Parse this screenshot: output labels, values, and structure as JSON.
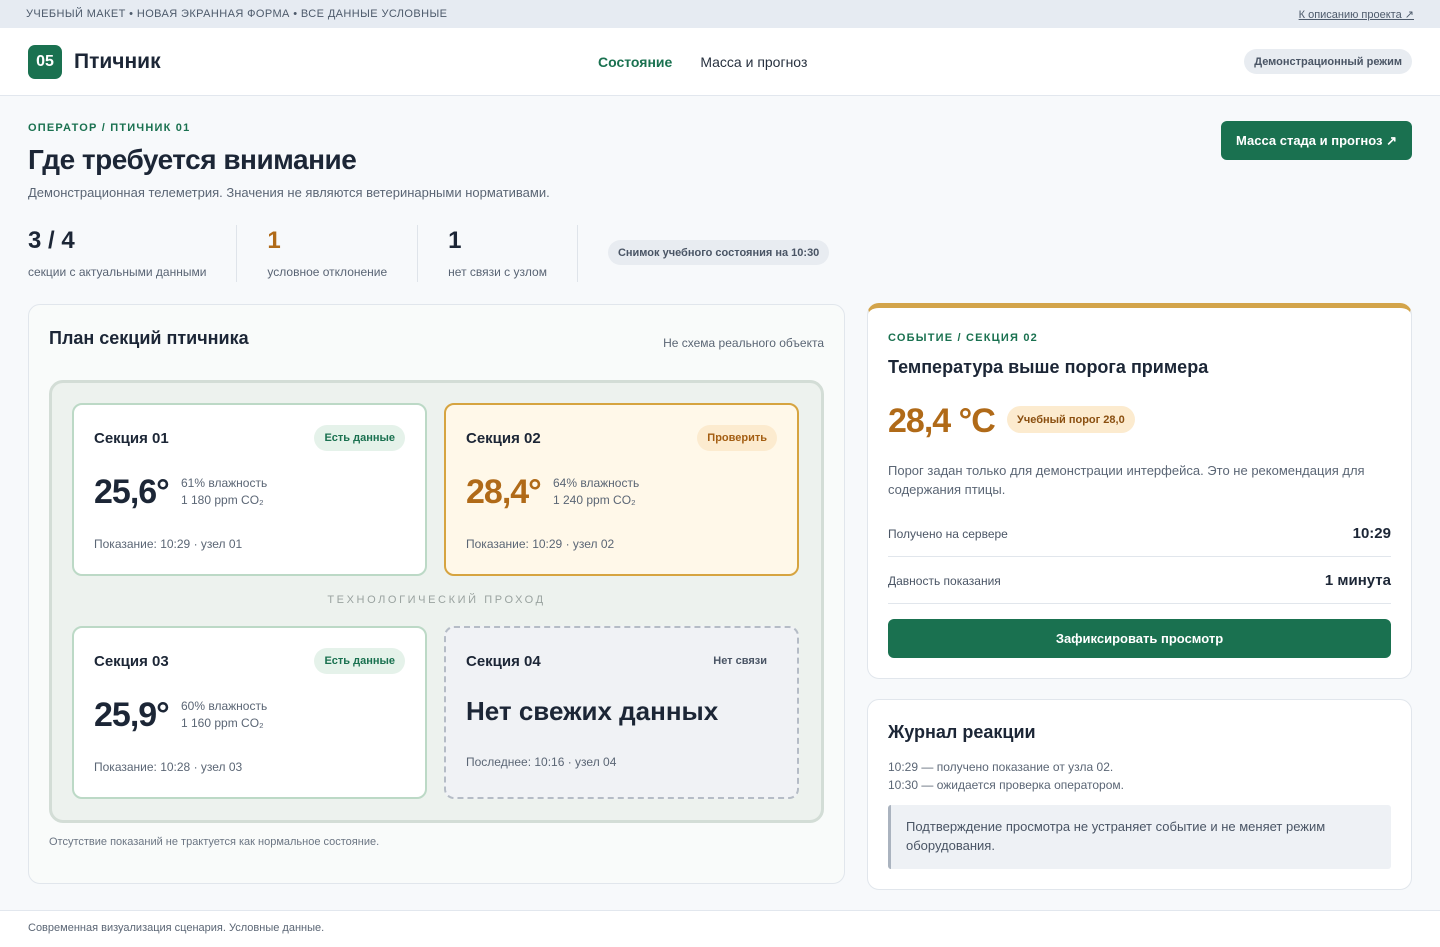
{
  "topbar": {
    "notice": "УЧЕБНЫЙ МАКЕТ • НОВАЯ ЭКРАННАЯ ФОРМА • ВСЕ ДАННЫЕ УСЛОВНЫЕ",
    "link": "К описанию проекта ↗"
  },
  "header": {
    "logo_number": "05",
    "app_name": "Птичник",
    "nav": [
      {
        "label": "Состояние",
        "active": true
      },
      {
        "label": "Масса и прогноз",
        "active": false
      }
    ],
    "mode": "Демонстрационный режим"
  },
  "page": {
    "breadcrumb": "ОПЕРАТОР / ПТИЧНИК 01",
    "title": "Где требуется внимание",
    "subtitle": "Демонстрационная телеметрия. Значения не являются ветеринарными нормативами.",
    "cta": "Масса стада и прогноз ↗"
  },
  "stats": [
    {
      "value": "3 / 4",
      "label": "секции с актуальными данными"
    },
    {
      "value": "1",
      "label": "условное отклонение"
    },
    {
      "value": "1",
      "label": "нет связи с узлом"
    }
  ],
  "snapshot": "Снимок учебного состояния на 10:30",
  "plan": {
    "title": "План секций птичника",
    "note": "Не схема реального объекта",
    "corridor": "ТЕХНОЛОГИЧЕСКИЙ ПРОХОД",
    "footnote": "Отсутствие показаний не трактуется как нормальное состояние.",
    "sections": [
      {
        "name": "Секция 01",
        "badge": "Есть данные",
        "temp": "25,6°",
        "humidity": "61% влажность",
        "co2": "1 180 ppm CO₂",
        "foot": "Показание: 10:29 · узел 01"
      },
      {
        "name": "Секция 02",
        "badge": "Проверить",
        "temp": "28,4°",
        "humidity": "64% влажность",
        "co2": "1 240 ppm CO₂",
        "foot": "Показание: 10:29 · узел 02"
      },
      {
        "name": "Секция 03",
        "badge": "Есть данные",
        "temp": "25,9°",
        "humidity": "60% влажность",
        "co2": "1 160 ppm CO₂",
        "foot": "Показание: 10:28 · узел 03"
      },
      {
        "name": "Секция 04",
        "badge": "Нет связи",
        "nodata": "Нет свежих данных",
        "foot": "Последнее: 10:16 · узел 04"
      }
    ]
  },
  "event": {
    "crumb": "СОБЫТИЕ / СЕКЦИЯ 02",
    "title": "Температура выше порога примера",
    "temp": "28,4 °C",
    "threshold": "Учебный порог 28,0",
    "description": "Порог задан только для демонстрации интерфейса. Это не рекомендация для содержания птицы.",
    "rows": [
      {
        "key": "Получено на сервере",
        "value": "10:29"
      },
      {
        "key": "Давность показания",
        "value": "1 минута"
      }
    ],
    "button": "Зафиксировать просмотр"
  },
  "journal": {
    "title": "Журнал реакции",
    "lines": [
      "10:29 — получено показание от узла 02.",
      "10:30 — ожидается проверка оператором."
    ],
    "note": "Подтверждение просмотра не устраняет событие и не меняет режим оборудования."
  },
  "footer": "Современная визуализация сценария. Условные данные.",
  "colors": {
    "accent": "#1a7150",
    "warning": "#b06a18",
    "warning_border": "#d6a440"
  }
}
